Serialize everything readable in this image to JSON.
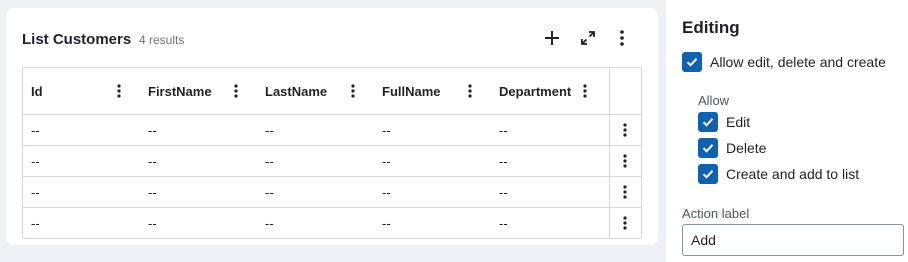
{
  "list": {
    "title": "List Customers",
    "result_count": "4 results",
    "icons": [
      "plus-icon",
      "expand-icon",
      "more-vertical-icon"
    ]
  },
  "table": {
    "columns": [
      "Id",
      "FirstName",
      "LastName",
      "FullName",
      "Department"
    ],
    "rows": [
      [
        "--",
        "--",
        "--",
        "--",
        "--"
      ],
      [
        "--",
        "--",
        "--",
        "--",
        "--"
      ],
      [
        "--",
        "--",
        "--",
        "--",
        "--"
      ],
      [
        "--",
        "--",
        "--",
        "--",
        "--"
      ]
    ]
  },
  "panel": {
    "title": "Editing",
    "main_option": {
      "label": "Allow edit, delete and create",
      "checked": true
    },
    "allow_heading": "Allow",
    "allow_options": [
      {
        "label": "Edit",
        "checked": true
      },
      {
        "label": "Delete",
        "checked": true
      },
      {
        "label": "Create and add to list",
        "checked": true
      }
    ],
    "action_label": {
      "label": "Action label",
      "value": "Add"
    }
  },
  "colors": {
    "checkbox": "#0f62ad",
    "background": "#edf1f5",
    "border": "#d4d9df"
  }
}
